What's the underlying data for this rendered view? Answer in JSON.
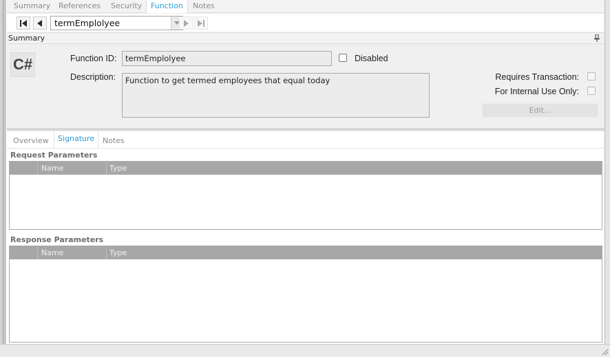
{
  "tabs": {
    "summary": "Summary",
    "references": "References",
    "security": "Security",
    "function": "Function",
    "notes": "Notes"
  },
  "navigator": {
    "current": "termEmplolyee"
  },
  "summary_section": {
    "title": "Summary",
    "language_badge": "C#",
    "function_id_label": "Function ID:",
    "function_id_value": "termEmplolyee",
    "disabled_label": "Disabled",
    "description_label": "Description:",
    "description_value": "Function to get termed employees that equal today",
    "requires_transaction_label": "Requires Transaction:",
    "internal_use_label": "For Internal Use Only:",
    "edit_button": "Edit..."
  },
  "sub_tabs": {
    "overview": "Overview",
    "signature": "Signature",
    "notes": "Notes"
  },
  "request_parameters": {
    "title": "Request Parameters",
    "columns": [
      "Name",
      "Type"
    ],
    "rows": []
  },
  "response_parameters": {
    "title": "Response Parameters",
    "columns": [
      "Name",
      "Type"
    ],
    "rows": []
  },
  "colors": {
    "active_tab": "#2a9bd8",
    "grid_header": "#a7a7a7"
  }
}
